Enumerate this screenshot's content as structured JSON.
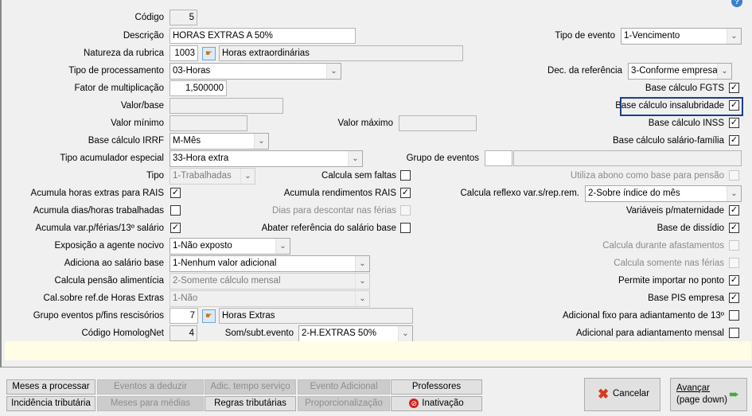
{
  "form": {
    "codigo": {
      "label": "Código",
      "value": "5"
    },
    "descricao": {
      "label": "Descrição",
      "value": "HORAS EXTRAS A 50%"
    },
    "natureza": {
      "label": "Natureza da rubrica",
      "code": "1003",
      "desc": "Horas extraordinárias"
    },
    "tipo_processamento": {
      "label": "Tipo de processamento",
      "value": "03-Horas"
    },
    "fator": {
      "label": "Fator de multiplicação",
      "value": "1,500000"
    },
    "valor_base": {
      "label": "Valor/base",
      "value": ""
    },
    "valor_minimo": {
      "label": "Valor mínimo",
      "value": ""
    },
    "valor_maximo": {
      "label": "Valor máximo",
      "value": ""
    },
    "base_irrf": {
      "label": "Base cálculo IRRF",
      "value": "M-Mês"
    },
    "tipo_acumulador": {
      "label": "Tipo acumulador especial",
      "value": "33-Hora extra"
    },
    "grupo_eventos": {
      "label": "Grupo de eventos",
      "code": "",
      "desc": ""
    },
    "tipo": {
      "label": "Tipo",
      "value": "1-Trabalhadas"
    },
    "exposicao": {
      "label": "Exposição a agente nocivo",
      "value": "1-Não exposto"
    },
    "adiciona": {
      "label": "Adiciona ao salário base",
      "value": "1-Nenhum valor adicional"
    },
    "pensao": {
      "label": "Calcula pensão alimentícia",
      "value": "2-Somente cálculo mensal"
    },
    "cal_sobre": {
      "label": "Cal.sobre ref.de Horas Extras",
      "value": "1-Não"
    },
    "grupo_rescisorios": {
      "label": "Grupo eventos p/fins rescisórios",
      "code": "7",
      "desc": "Horas Extras"
    },
    "homolognet": {
      "label": "Código HomologNet",
      "value": "4"
    },
    "som_subt": {
      "label": "Som/subt.evento",
      "value": "2-H.EXTRAS 50%"
    },
    "tipo_evento": {
      "label": "Tipo de evento",
      "value": "1-Vencimento"
    },
    "dec_referencia": {
      "label": "Dec. da referência",
      "value": "3-Conforme empresa"
    },
    "calcula_reflexo": {
      "label": "Calcula reflexo var.s/rep.rem.",
      "value": "2-Sobre índice do mês"
    }
  },
  "checks_left": [
    {
      "label": "Acumula horas extras para RAIS",
      "checked": true
    },
    {
      "label": "Acumula dias/horas trabalhadas",
      "checked": false
    },
    {
      "label": "Acumula var.p/férias/13º salário",
      "checked": true
    }
  ],
  "checks_mid": [
    {
      "label": "Calcula sem faltas",
      "checked": false,
      "disabled": false
    },
    {
      "label": "Acumula rendimentos RAIS",
      "checked": true,
      "disabled": false
    },
    {
      "label": "Dias para descontar nas férias",
      "checked": false,
      "disabled": true
    },
    {
      "label": "Abater referência do salário base",
      "checked": false,
      "disabled": false
    }
  ],
  "checks_right": [
    {
      "label": "Base cálculo FGTS",
      "checked": true,
      "disabled": false
    },
    {
      "label": "Base cálculo insalubridade",
      "checked": true,
      "disabled": false
    },
    {
      "label": "Base cálculo INSS",
      "checked": true,
      "disabled": false
    },
    {
      "label": "Base cálculo salário-família",
      "checked": true,
      "disabled": false
    },
    {
      "label": "Utiliza abono como base para pensão",
      "checked": false,
      "disabled": true
    },
    {
      "label": "Variáveis p/maternidade",
      "checked": true,
      "disabled": false
    },
    {
      "label": "Base de dissídio",
      "checked": true,
      "disabled": false
    },
    {
      "label": "Calcula durante afastamentos",
      "checked": false,
      "disabled": true
    },
    {
      "label": "Calcula somente nas férias",
      "checked": false,
      "disabled": true
    },
    {
      "label": "Permite importar no ponto",
      "checked": true,
      "disabled": false
    },
    {
      "label": "Base PIS empresa",
      "checked": true,
      "disabled": false
    },
    {
      "label": "Adicional fixo para adiantamento de 13º",
      "checked": false,
      "disabled": false
    },
    {
      "label": "Adicional para adiantamento mensal",
      "checked": false,
      "disabled": false
    }
  ],
  "buttons": {
    "meses_processar": "Meses a processar",
    "eventos_deduzir": "Eventos a deduzir",
    "adic_tempo": "Adic. tempo serviço",
    "evento_adicional": "Evento Adicional",
    "professores": "Professores",
    "incidencia": "Incidência tributária",
    "meses_medias": "Meses para médias",
    "regras": "Regras tributárias",
    "proporcionalizacao": "Proporcionalização",
    "inativacao": "Inativação",
    "cancelar": "Cancelar",
    "avancar": "Avançar",
    "avancar_sub": "(page down)"
  },
  "colors": {
    "highlight_border": "#1b3f8f",
    "hint_bar": "#fffde5"
  }
}
